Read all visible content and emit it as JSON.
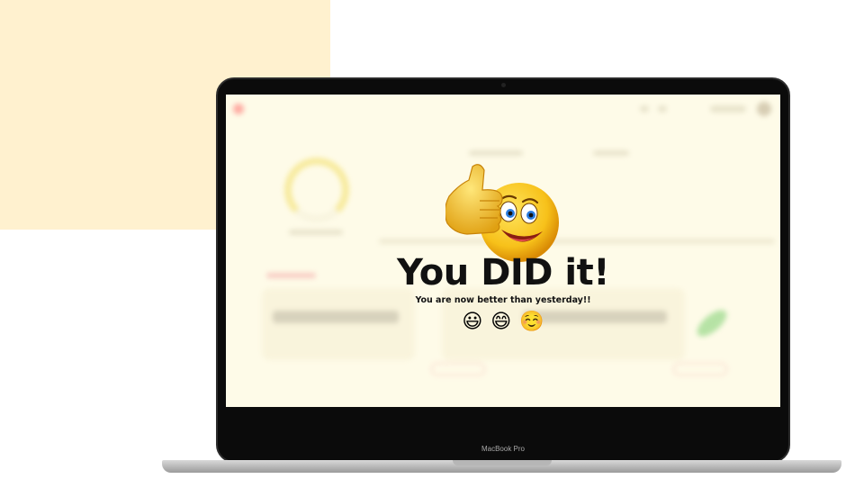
{
  "device": {
    "model_label": "MacBook Pro"
  },
  "celebration": {
    "headline": "You DID it!",
    "subline": "You are now better than yesterday!!",
    "emojis": [
      {
        "name": "grinning-face-icon",
        "glyph": "😃"
      },
      {
        "name": "beaming-face-icon",
        "glyph": "😄"
      },
      {
        "name": "smiling-face-icon",
        "glyph": "☺️"
      }
    ],
    "mascot_icon": "thumbs-up-smiley-icon"
  },
  "colors": {
    "background_block": "#fff1cf",
    "screen_background": "#fefbe8",
    "headline": "#111111",
    "mascot_yellow": "#f5c518"
  }
}
